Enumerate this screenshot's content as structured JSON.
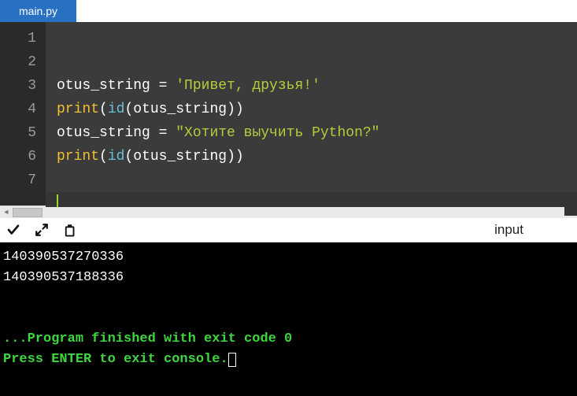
{
  "tab": {
    "title": "main.py"
  },
  "editor": {
    "line_numbers": [
      "1",
      "2",
      "3",
      "4",
      "5",
      "6",
      "7"
    ],
    "lines": {
      "l1": "",
      "l2": {
        "var": "otus_string",
        "op": " = ",
        "str": "'Привет, друзья!'"
      },
      "l3": {
        "fn": "print",
        "open": "(",
        "builtin": "id",
        "open2": "(",
        "arg": "otus_string",
        "close2": ")",
        "close": ")"
      },
      "l4": {
        "var": "otus_string",
        "op": " = ",
        "str": "\"Хотите выучить Python?\""
      },
      "l5": {
        "fn": "print",
        "open": "(",
        "builtin": "id",
        "open2": "(",
        "arg": "otus_string",
        "close2": ")",
        "close": ")"
      },
      "l6": "",
      "l7": ""
    }
  },
  "toolbar": {
    "input_label": "input"
  },
  "console": {
    "out1": "140390537270336",
    "out2": "140390537188336",
    "blank": "",
    "blank2": "",
    "finish": "...Program finished with exit code 0",
    "prompt": "Press ENTER to exit console."
  }
}
